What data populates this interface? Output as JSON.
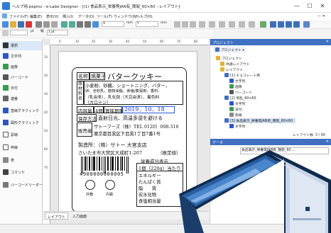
{
  "window": {
    "title": "ヘルプ用.pepmz - e-Labe Designer - [(1) 食品表示_栄養等JAN有_簡裂_60×60 - レイアウト]",
    "buttons": [
      "—",
      "☐",
      "✕"
    ]
  },
  "menu": {
    "items": [
      "ファイル(F)",
      "編集(E)",
      "表示(V)",
      "挿入(I)",
      "データ(D)",
      "ツール(T)",
      "ウィンドウ(W)",
      "ヘルプ(H)"
    ],
    "close_glyph": "— ✕"
  },
  "toolbar": {
    "field_x_label": "X",
    "field_y_label": "Y",
    "unit_mm": "mm",
    "unit_pt": "pt",
    "width_label": "幅",
    "size_value": "1 pt"
  },
  "sidebar": {
    "items": [
      {
        "label": "選択",
        "icon": "cursor-icon"
      },
      {
        "label": "文字列",
        "icon": "text-icon"
      },
      {
        "label": "画像",
        "icon": "image-icon"
      },
      {
        "label": "バーコード",
        "icon": "barcode-icon"
      },
      {
        "label": "日付",
        "icon": "calendar-icon"
      },
      {
        "label": "連番",
        "icon": "serial-icon"
      },
      {
        "label": "直線グラフィック",
        "icon": "line-icon"
      },
      {
        "label": "図形グラフィック",
        "icon": "shape-icon"
      },
      {
        "label": "罫線",
        "icon": "rule-icon"
      },
      {
        "label": "枠線",
        "icon": "frame-icon"
      },
      {
        "label": "表",
        "icon": "table-icon"
      },
      {
        "label": "コマンド",
        "icon": "command-icon"
      },
      {
        "label": "バーコードリーダー",
        "icon": "reader-icon"
      }
    ]
  },
  "ruler": {
    "ticks": [
      "0",
      "10",
      "20",
      "30",
      "40",
      "50",
      "60",
      "70",
      "80"
    ]
  },
  "label": {
    "name_key": "名称",
    "name_val": "焼菓子",
    "product_name": "バタークッキー",
    "ingredients_key": "原材料名",
    "ingredients": [
      "小麦粉、砂糖、ショートニング、バター、",
      "卵、全粉乳、植物油脂、食塩/膨張剤、香料、",
      "（乳由来）、乳化剤（大豆由来）、着色料",
      "（カロテン）"
    ],
    "content_key": "内容量",
    "content_val": "4個",
    "expiry_key": "賞味期限",
    "expiry_val": "2019．10．18",
    "storage_key": "保存方法",
    "storage_val": "直射日光、高温多湿を避ける",
    "seller_key": "販売者",
    "seller_line1": "サトーフーズ（株）TEL 0120）098-310",
    "seller_line2": "東京都目黒区下目黒1丁目7番1号",
    "maker_line": "製造所：（株）サトー 大宮支店",
    "maker_addr": "さいたま市大宮区大成町1-207",
    "recommend": "（推定値）",
    "barcode_number": "4900000000005",
    "nutrition_title": "栄養成分表示",
    "nutrition_serving": "1個（220g）当たり",
    "nutrition_rows": [
      "エネルギー",
      "たんぱく質",
      "脂　　質",
      "炭水化物",
      "食塩相当量"
    ],
    "recycle_labels": [
      "外箱",
      "内袋"
    ]
  },
  "tabs": {
    "layout": "レイアウト",
    "input": "入力画面"
  },
  "project_panel": {
    "title": "プロジェクト",
    "sub_title": "プロジェクト",
    "items": [
      "プロジェクト",
      "共通レイアウト",
      "レイアウト",
      "[1] チョコレート用",
      "文字列",
      "画像",
      "バーコード",
      "[2] 吊乱_60×60",
      "文字列",
      "日付",
      "罫線",
      "[3] 食品表示_栄養等JAN有_簡裂_60×60",
      "文字列"
    ],
    "footer": "レイアウト数: 3 / 99"
  },
  "data_panel": {
    "title": "データ",
    "field_value": "食品表示_栄養等JAN有_簡裂_60 ..."
  },
  "colors": {
    "accent": "#3f70c1",
    "highlight_text": "#1a34c8",
    "selection": "#cfe0f5"
  }
}
